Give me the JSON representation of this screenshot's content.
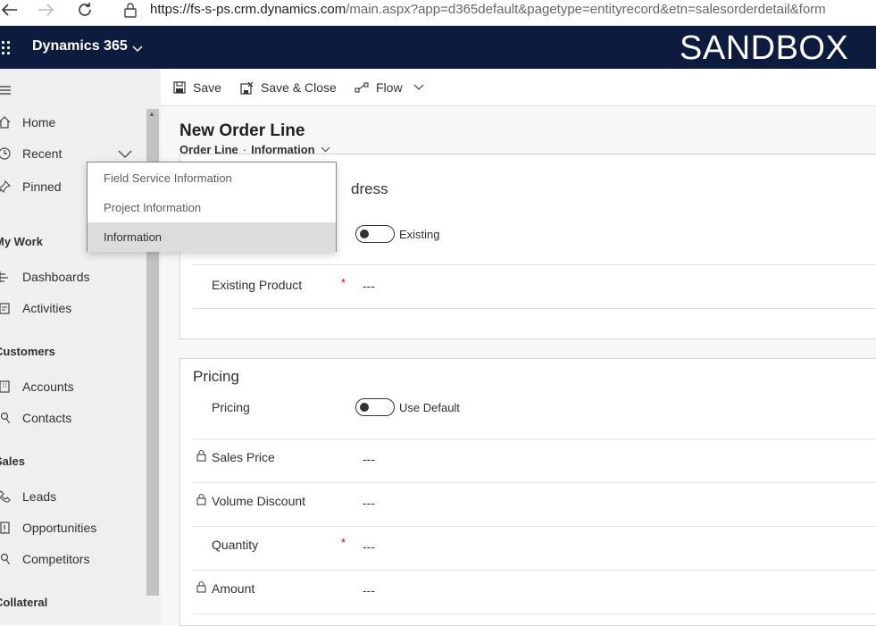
{
  "browser": {
    "url_domain": "https://fs-s-ps.crm.dynamics.com",
    "url_path": "/main.aspx?app=d365default&pagetype=entityrecord&etn=salesorderdetail&form"
  },
  "header": {
    "app_name": "Dynamics 365",
    "environment_label": "SANDBOX",
    "background_color": "#0d1b3e"
  },
  "sidebar": {
    "items": [
      {
        "label": "Home",
        "icon": "home-icon"
      },
      {
        "label": "Recent",
        "icon": "clock-icon"
      },
      {
        "label": "Pinned",
        "icon": "pin-icon"
      }
    ],
    "sections": [
      {
        "title": "My Work",
        "items": [
          {
            "label": "Dashboards",
            "icon": "dashboard-icon"
          },
          {
            "label": "Activities",
            "icon": "activities-icon"
          }
        ]
      },
      {
        "title": "Customers",
        "items": [
          {
            "label": "Accounts",
            "icon": "building-icon"
          },
          {
            "label": "Contacts",
            "icon": "person-icon"
          }
        ]
      },
      {
        "title": "Sales",
        "items": [
          {
            "label": "Leads",
            "icon": "phone-icon"
          },
          {
            "label": "Opportunities",
            "icon": "opportunity-icon"
          },
          {
            "label": "Competitors",
            "icon": "person-icon"
          }
        ]
      },
      {
        "title": "Collateral",
        "items": []
      }
    ]
  },
  "commands": {
    "save": "Save",
    "save_close": "Save & Close",
    "flow": "Flow"
  },
  "record": {
    "title": "New Order Line",
    "entity": "Order Line",
    "separator": "·",
    "form": "Information"
  },
  "form_selector": {
    "options": [
      "Field Service Information",
      "Project Information",
      "Information"
    ],
    "selected": "Information"
  },
  "sections": {
    "general": {
      "title_partial": "dress",
      "product_toggle_label": "Existing",
      "existing_product_label": "Existing Product",
      "existing_product_value": "---"
    },
    "pricing": {
      "title": "Pricing",
      "pricing_label": "Pricing",
      "pricing_toggle_label": "Use Default",
      "fields": [
        {
          "label": "Sales Price",
          "value": "---",
          "locked": true,
          "required": false
        },
        {
          "label": "Volume Discount",
          "value": "---",
          "locked": true,
          "required": false
        },
        {
          "label": "Quantity",
          "value": "---",
          "locked": false,
          "required": true
        },
        {
          "label": "Amount",
          "value": "---",
          "locked": true,
          "required": false
        }
      ]
    }
  },
  "required_marker": "*"
}
